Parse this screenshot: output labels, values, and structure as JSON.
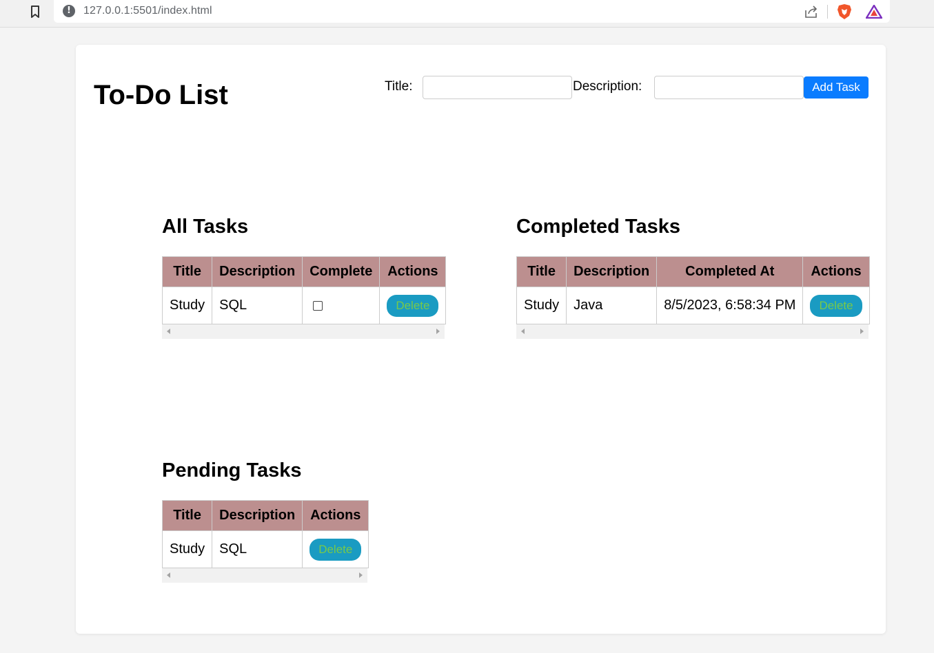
{
  "browser": {
    "url": "127.0.0.1:5501/index.html"
  },
  "header": {
    "title": "To-Do List",
    "title_label": "Title:",
    "title_value": "",
    "description_label": "Description:",
    "description_value": "",
    "add_button": "Add Task"
  },
  "all_tasks": {
    "heading": "All Tasks",
    "columns": [
      "Title",
      "Description",
      "Complete",
      "Actions"
    ],
    "rows": [
      {
        "title": "Study",
        "description": "SQL",
        "complete": false,
        "action": "Delete"
      }
    ]
  },
  "completed_tasks": {
    "heading": "Completed Tasks",
    "columns": [
      "Title",
      "Description",
      "Completed At",
      "Actions"
    ],
    "rows": [
      {
        "title": "Study",
        "description": "Java",
        "completed_at": "8/5/2023, 6:58:34 PM",
        "action": "Delete"
      }
    ]
  },
  "pending_tasks": {
    "heading": "Pending Tasks",
    "columns": [
      "Title",
      "Description",
      "Actions"
    ],
    "rows": [
      {
        "title": "Study",
        "description": "SQL",
        "action": "Delete"
      }
    ]
  },
  "colors": {
    "header_bg": "#bc8f8f",
    "add_button_bg": "#0a7cff",
    "delete_button_bg": "#1a9bc2",
    "delete_button_text": "#78c94a"
  }
}
